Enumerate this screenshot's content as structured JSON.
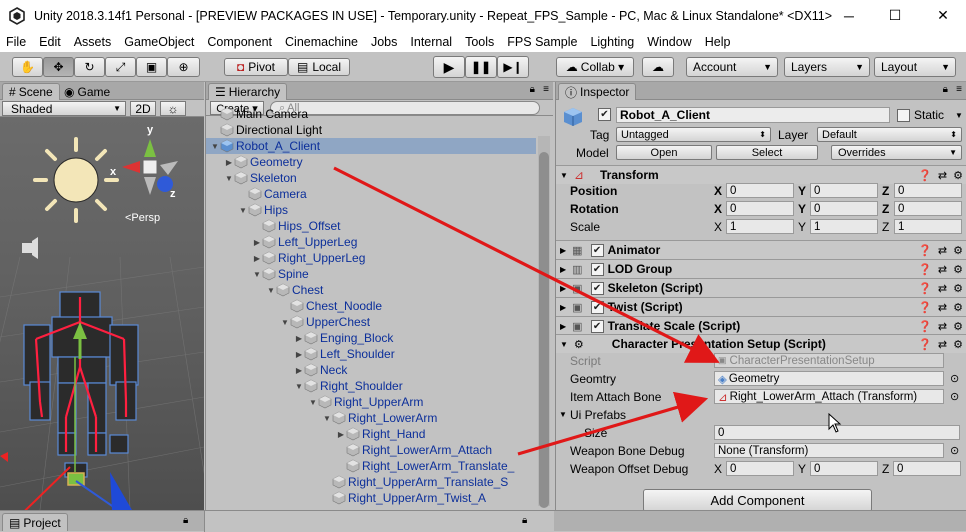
{
  "window": {
    "title": "Unity 2018.3.14f1 Personal - [PREVIEW PACKAGES IN USE] - Temporary.unity - Repeat_FPS_Sample - PC, Mac & Linux Standalone* <DX11>",
    "minimize": "─",
    "maximize": "☐",
    "close": "✕"
  },
  "menu": [
    "File",
    "Edit",
    "Assets",
    "GameObject",
    "Component",
    "Cinemachine",
    "Jobs",
    "Internal",
    "Tools",
    "FPS Sample",
    "Lighting",
    "Window",
    "Help"
  ],
  "toolbar": {
    "pivot": "Pivot",
    "local": "Local",
    "collab": "Collab ▾",
    "account": "Account",
    "layers": "Layers",
    "layout": "Layout"
  },
  "scene": {
    "tab_scene": "Scene",
    "tab_game": "Game",
    "shading": "Shaded",
    "mode2d": "2D",
    "persp": "<Persp",
    "gizmo_y": "y",
    "gizmo_x": "x",
    "gizmo_z": "z"
  },
  "hierarchy": {
    "tab": "Hierarchy",
    "create": "Create ▾",
    "search_placeholder": "All",
    "rows": [
      {
        "label": "Main Camera",
        "indent": 0,
        "fold": "",
        "color": "black"
      },
      {
        "label": "Directional Light",
        "indent": 0,
        "fold": "",
        "color": "black"
      },
      {
        "label": "Robot_A_Client",
        "indent": 0,
        "fold": "▼",
        "color": "blue",
        "selected": true
      },
      {
        "label": "Geometry",
        "indent": 1,
        "fold": "▶",
        "color": "blue"
      },
      {
        "label": "Skeleton",
        "indent": 1,
        "fold": "▼",
        "color": "blue"
      },
      {
        "label": "Camera",
        "indent": 2,
        "fold": "",
        "color": "blue"
      },
      {
        "label": "Hips",
        "indent": 2,
        "fold": "▼",
        "color": "blue"
      },
      {
        "label": "Hips_Offset",
        "indent": 3,
        "fold": "",
        "color": "blue"
      },
      {
        "label": "Left_UpperLeg",
        "indent": 3,
        "fold": "▶",
        "color": "blue"
      },
      {
        "label": "Right_UpperLeg",
        "indent": 3,
        "fold": "▶",
        "color": "blue"
      },
      {
        "label": "Spine",
        "indent": 3,
        "fold": "▼",
        "color": "blue"
      },
      {
        "label": "Chest",
        "indent": 4,
        "fold": "▼",
        "color": "blue"
      },
      {
        "label": "Chest_Noodle",
        "indent": 5,
        "fold": "",
        "color": "blue"
      },
      {
        "label": "UpperChest",
        "indent": 5,
        "fold": "▼",
        "color": "blue"
      },
      {
        "label": "Enging_Block",
        "indent": 6,
        "fold": "▶",
        "color": "blue"
      },
      {
        "label": "Left_Shoulder",
        "indent": 6,
        "fold": "▶",
        "color": "blue"
      },
      {
        "label": "Neck",
        "indent": 6,
        "fold": "▶",
        "color": "blue"
      },
      {
        "label": "Right_Shoulder",
        "indent": 6,
        "fold": "▼",
        "color": "blue"
      },
      {
        "label": "Right_UpperArm",
        "indent": 7,
        "fold": "▼",
        "color": "blue"
      },
      {
        "label": "Right_LowerArm",
        "indent": 8,
        "fold": "▼",
        "color": "blue"
      },
      {
        "label": "Right_Hand",
        "indent": 9,
        "fold": "▶",
        "color": "blue"
      },
      {
        "label": "Right_LowerArm_Attach",
        "indent": 9,
        "fold": "",
        "color": "blue"
      },
      {
        "label": "Right_LowerArm_Translate_",
        "indent": 9,
        "fold": "",
        "color": "blue"
      },
      {
        "label": "Right_UpperArm_Translate_S",
        "indent": 8,
        "fold": "",
        "color": "blue"
      },
      {
        "label": "Right_UpperArm_Twist_A",
        "indent": 8,
        "fold": "",
        "color": "blue"
      }
    ]
  },
  "inspector": {
    "tab": "Inspector",
    "object_name": "Robot_A_Client",
    "static_label": "Static",
    "tag_label": "Tag",
    "tag_value": "Untagged",
    "layer_label": "Layer",
    "layer_value": "Default",
    "model_label": "Model",
    "open": "Open",
    "select": "Select",
    "overrides": "Overrides",
    "transform": {
      "title": "Transform",
      "position": "Position",
      "rotation": "Rotation",
      "scale": "Scale",
      "x": "X",
      "y": "Y",
      "z": "Z",
      "pos": [
        "0",
        "0",
        "0"
      ],
      "rot": [
        "0",
        "0",
        "0"
      ],
      "scl": [
        "1",
        "1",
        "1"
      ]
    },
    "components": [
      "Animator",
      "LOD Group",
      "Skeleton (Script)",
      "Twist (Script)",
      "Translate Scale (Script)"
    ],
    "cps": {
      "title": "Character Presentation Setup (Script)",
      "script_label": "Script",
      "script_value": "CharacterPresentationSetup",
      "geomtry_label": "Geomtry",
      "geomtry_value": "Geometry",
      "attach_label": "Item Attach Bone",
      "attach_value": "Right_LowerArm_Attach (Transform)",
      "prefabs_label": "Ui Prefabs",
      "size_label": "Size",
      "size_value": "0",
      "wbd_label": "Weapon Bone Debug",
      "wbd_value": "None (Transform)",
      "wod_label": "Weapon Offset Debug",
      "wod": [
        "0",
        "0",
        "0"
      ]
    },
    "add_component": "Add Component"
  },
  "bottom": {
    "tab_project": "Project"
  },
  "colors": {
    "arrow": "#e01818",
    "selected_row": "#8fa6c4",
    "blue_text": "#0c2f9a"
  }
}
